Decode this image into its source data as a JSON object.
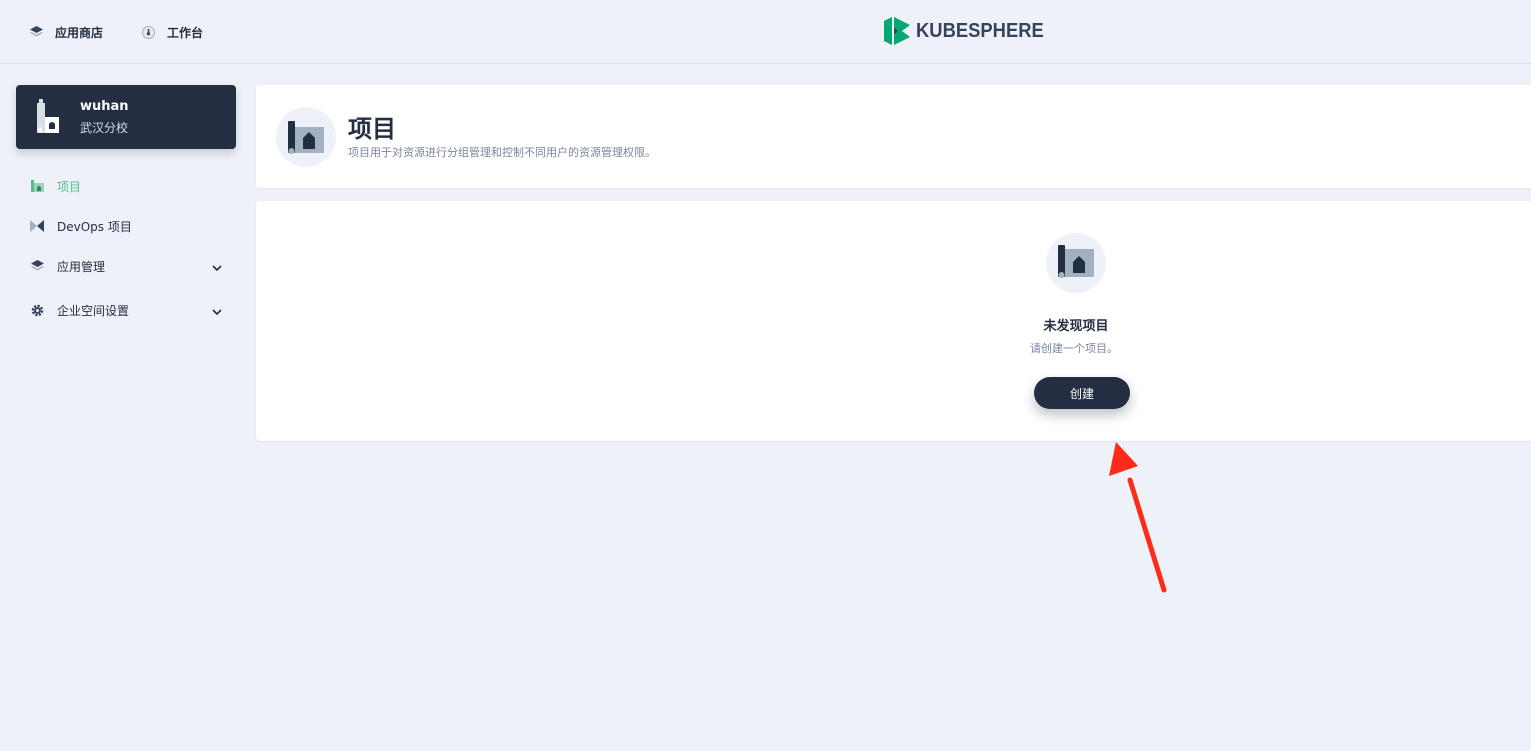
{
  "topbar": {
    "app_store_label": "应用商店",
    "workbench_label": "工作台",
    "logo_text": "KUBESPHERE"
  },
  "workspace": {
    "name": "wuhan",
    "description": "武汉分校"
  },
  "sidebar": {
    "items": [
      {
        "label": "项目",
        "icon": "project-icon",
        "active": true
      },
      {
        "label": "DevOps 项目",
        "icon": "devops-icon"
      },
      {
        "label": "应用管理",
        "icon": "layers-icon",
        "expandable": true
      },
      {
        "label": "企业空间设置",
        "icon": "gear-icon",
        "expandable": true
      }
    ]
  },
  "header": {
    "title": "项目",
    "description": "项目用于对资源进行分组管理和控制不同用户的资源管理权限。"
  },
  "empty_state": {
    "title": "未发现项目",
    "description": "请创建一个项目。",
    "create_label": "创建"
  },
  "colors": {
    "accent": "#55bc8a",
    "dark": "#242e42",
    "background": "#eef2f8",
    "annotation_arrow": "#ff2a1a"
  }
}
